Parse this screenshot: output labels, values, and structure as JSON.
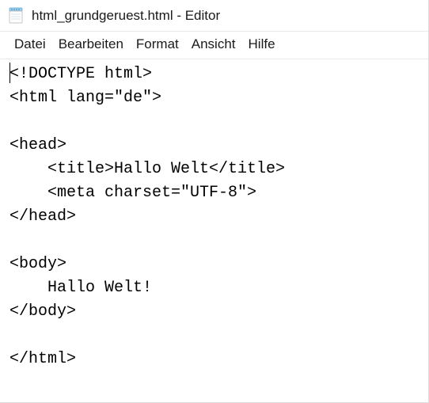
{
  "window": {
    "title": "html_grundgeruest.html - Editor"
  },
  "menu": {
    "items": [
      "Datei",
      "Bearbeiten",
      "Format",
      "Ansicht",
      "Hilfe"
    ]
  },
  "editor": {
    "content": "<!DOCTYPE html>\n<html lang=\"de\">\n\n<head>\n    <title>Hallo Welt</title>\n    <meta charset=\"UTF-8\">\n</head>\n\n<body>\n    Hallo Welt!\n</body>\n\n</html>"
  }
}
